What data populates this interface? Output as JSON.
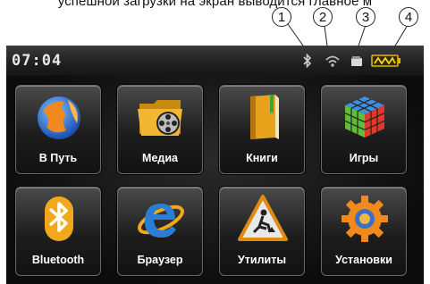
{
  "caption": "успешной загрузки на экран выводится главное м",
  "callouts": [
    "1",
    "2",
    "3",
    "4"
  ],
  "status": {
    "time": "07:04",
    "icons": [
      "bluetooth-icon",
      "wifi-icon",
      "storage-card-icon",
      "battery-icon"
    ]
  },
  "menu": {
    "items": [
      {
        "label": "В Путь",
        "icon": "globe-navigation-icon"
      },
      {
        "label": "Медиа",
        "icon": "media-folder-icon"
      },
      {
        "label": "Книги",
        "icon": "book-icon"
      },
      {
        "label": "Игры",
        "icon": "rubiks-cube-icon"
      },
      {
        "label": "Bluetooth",
        "icon": "bluetooth-icon"
      },
      {
        "label": "Браузер",
        "icon": "internet-explorer-icon"
      },
      {
        "label": "Утилиты",
        "icon": "roadwork-sign-icon"
      },
      {
        "label": "Установки",
        "icon": "gear-icon"
      }
    ]
  }
}
